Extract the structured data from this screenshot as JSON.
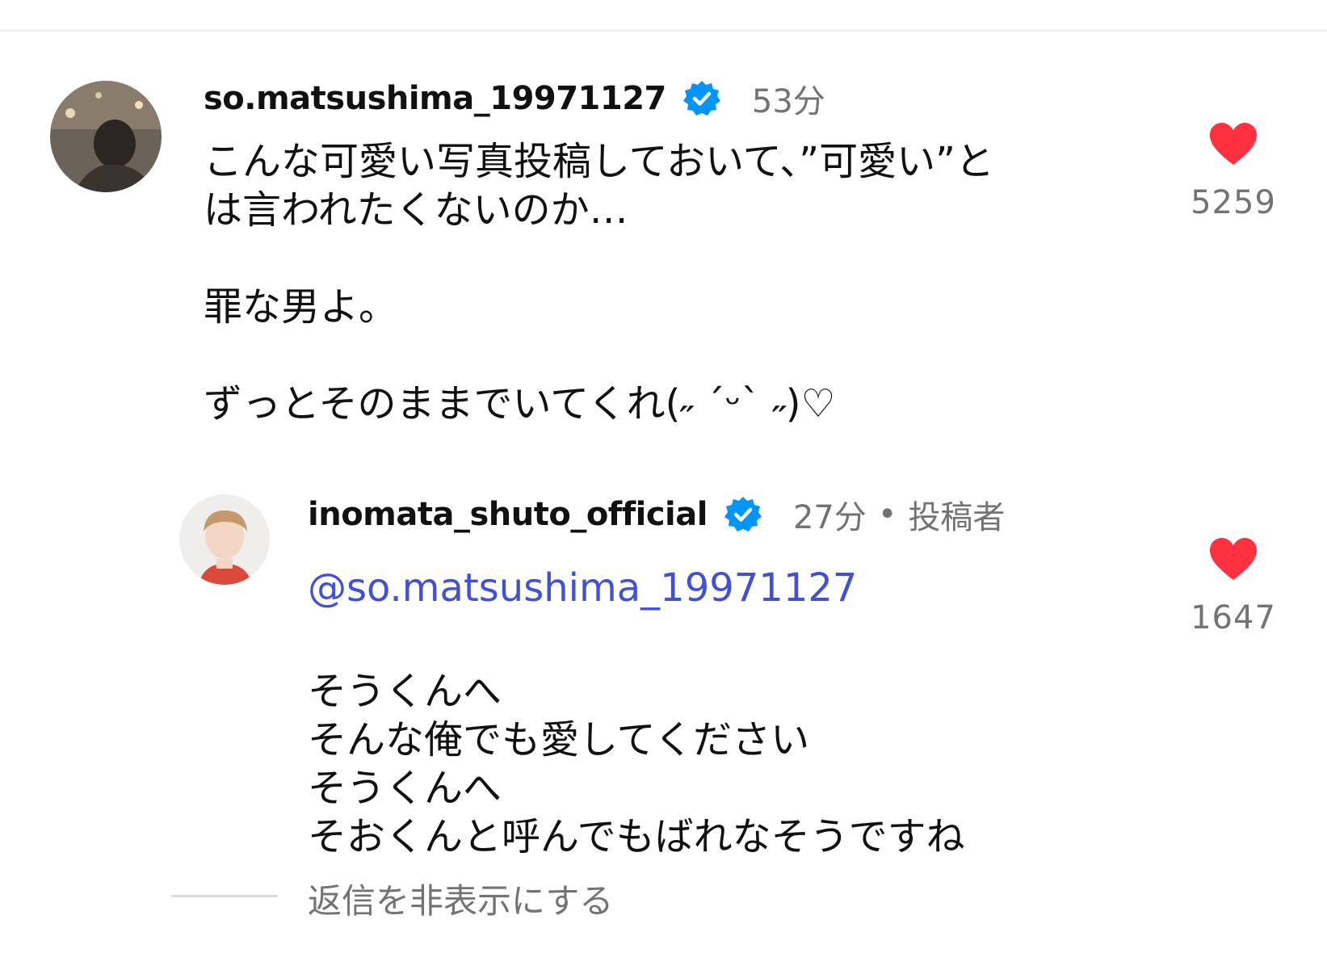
{
  "comments": [
    {
      "username": "so.matsushima_19971127",
      "time": "53分",
      "text": "こんな可愛い写真投稿しておいて、”可愛い”と\nは言われたくないのか…\n\n罪な男よ。\n\nずっとそのままでいてくれ(˶ ˊᵕˋ ˶)♡",
      "likes": "5259",
      "verified_icon": "verified-badge-icon",
      "heart_icon": "heart-icon",
      "heart_color": "#ff3040"
    }
  ],
  "reply": {
    "username": "inomata_shuto_official",
    "time": "27分",
    "separator": "•",
    "author_tag": "投稿者",
    "mention": "@so.matsushima_19971127",
    "text": "そうくんへ\nそんな俺でも愛してください\nそうくんへ\nそおくんと呼んでもばれなそうですね",
    "likes": "1647",
    "verified_icon": "verified-badge-icon",
    "heart_icon": "heart-icon",
    "heart_color": "#ff3040"
  },
  "hide_replies_label": "返信を非表示にする",
  "colors": {
    "verified": "#0095f6",
    "mention": "#4150d8",
    "muted": "#737373"
  }
}
